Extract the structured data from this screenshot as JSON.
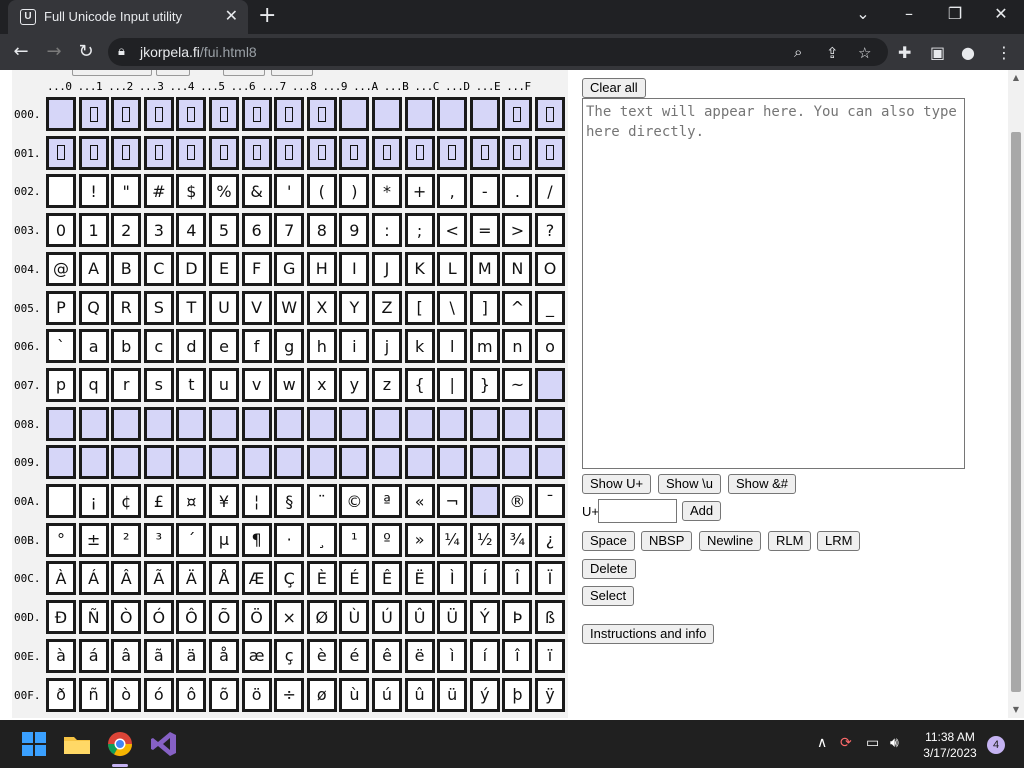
{
  "browser": {
    "tab_title": "Full Unicode Input utility",
    "tab_close": "✕",
    "new_tab": "+",
    "url_host": "jkorpela.fi",
    "url_path": "/fui.html8"
  },
  "grid": {
    "column_header": "...0 ...1 ...2 ...3 ...4 ...5 ...6 ...7 ...8 ...9 ...A ...B ...C ...D ...E ...F",
    "rows": [
      {
        "label": "000.",
        "cells": [
          "",
          "▯",
          "▯",
          "▯",
          "▯",
          "▯",
          "▯",
          "▯",
          "▯",
          "",
          "",
          "",
          "",
          "",
          "▯",
          "▯"
        ]
      },
      {
        "label": "001.",
        "cells": [
          "▯",
          "▯",
          "▯",
          "▯",
          "▯",
          "▯",
          "▯",
          "▯",
          "▯",
          "▯",
          "▯",
          "▯",
          "▯",
          "▯",
          "▯",
          "▯"
        ]
      },
      {
        "label": "002.",
        "cells": [
          "",
          "!",
          "\"",
          "#",
          "$",
          "%",
          "&",
          "'",
          "(",
          ")",
          "*",
          "+",
          ",",
          "-",
          ".",
          "/"
        ]
      },
      {
        "label": "003.",
        "cells": [
          "0",
          "1",
          "2",
          "3",
          "4",
          "5",
          "6",
          "7",
          "8",
          "9",
          ":",
          ";",
          "<",
          "=",
          ">",
          "?"
        ]
      },
      {
        "label": "004.",
        "cells": [
          "@",
          "A",
          "B",
          "C",
          "D",
          "E",
          "F",
          "G",
          "H",
          "I",
          "J",
          "K",
          "L",
          "M",
          "N",
          "O"
        ]
      },
      {
        "label": "005.",
        "cells": [
          "P",
          "Q",
          "R",
          "S",
          "T",
          "U",
          "V",
          "W",
          "X",
          "Y",
          "Z",
          "[",
          "\\",
          "]",
          "^",
          "_"
        ]
      },
      {
        "label": "006.",
        "cells": [
          "`",
          "a",
          "b",
          "c",
          "d",
          "e",
          "f",
          "g",
          "h",
          "i",
          "j",
          "k",
          "l",
          "m",
          "n",
          "o"
        ]
      },
      {
        "label": "007.",
        "cells": [
          "p",
          "q",
          "r",
          "s",
          "t",
          "u",
          "v",
          "w",
          "x",
          "y",
          "z",
          "{",
          "|",
          "}",
          "~",
          ""
        ]
      },
      {
        "label": "008.",
        "cells": [
          "",
          "",
          "",
          "",
          "",
          "",
          "",
          "",
          "",
          "",
          "",
          "",
          "",
          "",
          "",
          ""
        ]
      },
      {
        "label": "009.",
        "cells": [
          "",
          "",
          "",
          "",
          "",
          "",
          "",
          "",
          "",
          "",
          "",
          "",
          "",
          "",
          "",
          ""
        ]
      },
      {
        "label": "00A.",
        "cells": [
          "",
          "¡",
          "¢",
          "£",
          "¤",
          "¥",
          "¦",
          "§",
          "¨",
          "©",
          "ª",
          "«",
          "¬",
          "",
          "®",
          "¯"
        ]
      },
      {
        "label": "00B.",
        "cells": [
          "°",
          "±",
          "²",
          "³",
          "´",
          "µ",
          "¶",
          "·",
          "¸",
          "¹",
          "º",
          "»",
          "¼",
          "½",
          "¾",
          "¿"
        ]
      },
      {
        "label": "00C.",
        "cells": [
          "À",
          "Á",
          "Â",
          "Ã",
          "Ä",
          "Å",
          "Æ",
          "Ç",
          "È",
          "É",
          "Ê",
          "Ë",
          "Ì",
          "Í",
          "Î",
          "Ï"
        ]
      },
      {
        "label": "00D.",
        "cells": [
          "Ð",
          "Ñ",
          "Ò",
          "Ó",
          "Ô",
          "Õ",
          "Ö",
          "×",
          "Ø",
          "Ù",
          "Ú",
          "Û",
          "Ü",
          "Ý",
          "Þ",
          "ß"
        ]
      },
      {
        "label": "00E.",
        "cells": [
          "à",
          "á",
          "â",
          "ã",
          "ä",
          "å",
          "æ",
          "ç",
          "è",
          "é",
          "ê",
          "ë",
          "ì",
          "í",
          "î",
          "ï"
        ]
      },
      {
        "label": "00F.",
        "cells": [
          "ð",
          "ñ",
          "ò",
          "ó",
          "ô",
          "õ",
          "ö",
          "÷",
          "ø",
          "ù",
          "ú",
          "û",
          "ü",
          "ý",
          "þ",
          "ÿ"
        ]
      }
    ]
  },
  "panel": {
    "clear_all": "Clear all",
    "textarea_placeholder": "The text will appear here. You can also type here directly.",
    "show_u_plus": "Show U+",
    "show_backslash_u": "Show \\u",
    "show_amp_hash": "Show &#",
    "u_prefix": "U+",
    "add": "Add",
    "space": "Space",
    "nbsp": "NBSP",
    "newline": "Newline",
    "rlm": "RLM",
    "lrm": "LRM",
    "delete": "Delete",
    "select": "Select",
    "instructions": "Instructions and info"
  },
  "taskbar": {
    "time": "11:38 AM",
    "date": "3/17/2023",
    "notification_count": "4"
  }
}
